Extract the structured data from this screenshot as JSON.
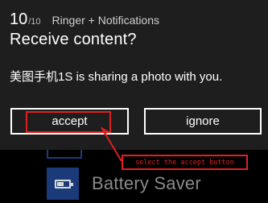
{
  "background": {
    "item_label": "Battery Saver",
    "item_icon": "battery-icon"
  },
  "dialog": {
    "counter_current": "10",
    "counter_total": "/10",
    "header_title": "Ringer + Notifications",
    "title": "Receive content?",
    "message": "美图手机1S is sharing a photo with you.",
    "accept_label": "accept",
    "ignore_label": "ignore"
  },
  "annotation": {
    "text": "select the accept button",
    "color": "#e02020"
  },
  "colors": {
    "dialog_bg": "#1e1e1e",
    "tile_blue": "#1a3a7a",
    "annotation_red": "#e02020"
  }
}
